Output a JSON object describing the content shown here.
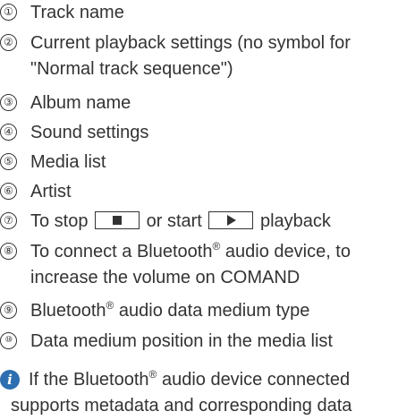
{
  "legend": [
    {
      "number": "①",
      "text": "Track name"
    },
    {
      "number": "②",
      "text_line1": "Current playback settings (no symbol for",
      "text_line2": "\"Normal track sequence\")"
    },
    {
      "number": "③",
      "text": "Album name"
    },
    {
      "number": "④",
      "text": "Sound settings"
    },
    {
      "number": "⑤",
      "text": "Media list"
    },
    {
      "number": "⑥",
      "text": "Artist"
    },
    {
      "number": "⑦",
      "text_before": "To stop",
      "text_middle": "or start",
      "text_after": "playback",
      "stop_icon": "stop-square-icon",
      "play_icon": "play-triangle-icon"
    },
    {
      "number": "⑧",
      "text_line1_before": "To connect a Bluetooth",
      "registered": "®",
      "text_line1_after": " audio device, to",
      "text_line2": "increase the volume on COMAND"
    },
    {
      "number": "⑨",
      "text_before": "Bluetooth",
      "registered": "®",
      "text_after": " audio data medium type"
    },
    {
      "number": "⑩",
      "text": "Data medium position in the media list"
    }
  ],
  "note": {
    "icon": "info-icon",
    "icon_glyph": "i",
    "text_line1_before": "If the Bluetooth",
    "registered": "®",
    "text_line1_after": " audio device connected",
    "text_line2": "supports metadata and corresponding data"
  },
  "colors": {
    "text": "#333333",
    "info_icon": "#2d6fb0"
  }
}
